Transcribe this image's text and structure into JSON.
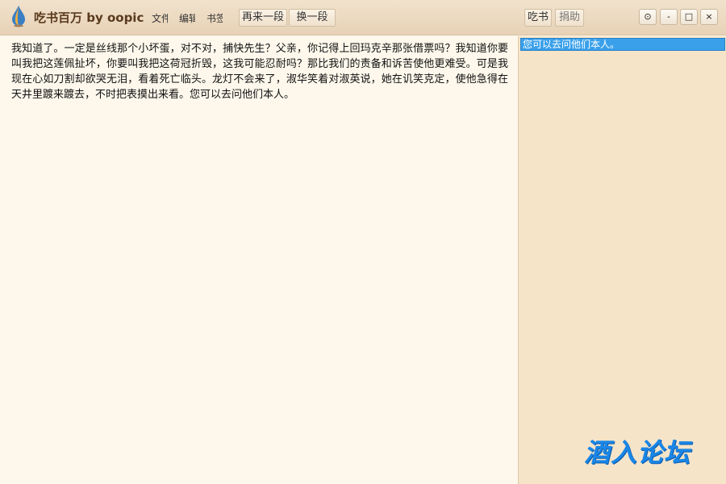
{
  "app": {
    "title": "吃书百万 by oopic",
    "icon": "drop-logo-icon"
  },
  "menu": {
    "items": [
      {
        "label": "文件"
      },
      {
        "label": "编辑"
      },
      {
        "label": "书签"
      }
    ]
  },
  "toolbar": {
    "again_label": "再来一段",
    "switch_label": "换一段",
    "eat_label": "吃书",
    "donate_label": "捐助"
  },
  "window_controls": {
    "settings": "⊙",
    "minimize": "-",
    "maximize": "□",
    "close": "×"
  },
  "content": {
    "text": "我知道了。一定是丝线那个小坏蛋，对不对，捕快先生？父亲，你记得上回玛克辛那张借票吗？我知道你要叫我把这莲佩扯坏，你要叫我把这荷冠折毁，这我可能忍耐吗？那比我们的责备和诉苦使他更难受。可是我现在心如刀割却欲哭无泪，看着死亡临头。龙灯不会来了，淑华笑着对淑英说，她在讥笑克定，使他急得在天井里踱来踱去，不时把表摸出来看。您可以去问他们本人。"
  },
  "side": {
    "selected_item": "您可以去问他们本人。"
  },
  "watermark": {
    "text": "酒入论坛"
  },
  "colors": {
    "titlebar": "#e9d6bb",
    "content_bg": "#fef8ec",
    "side_bg": "#f6e4c9",
    "selection": "#3aa0ea",
    "watermark": "#1a86e6"
  }
}
